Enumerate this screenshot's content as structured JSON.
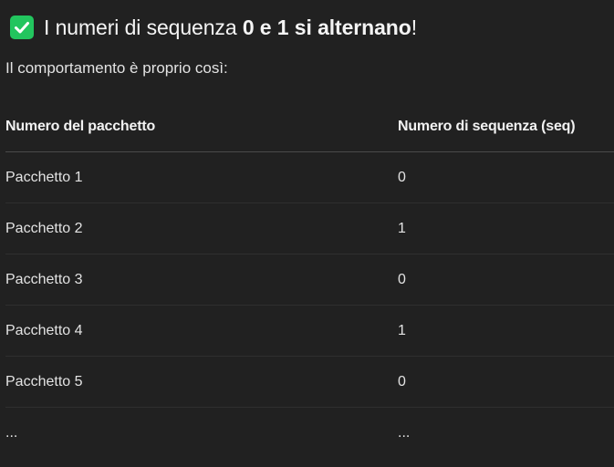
{
  "heading": {
    "icon": "check-box-icon",
    "icon_color": "#22c55e",
    "part1": "I numeri di sequenza ",
    "bold1": "0",
    "part2": " e ",
    "bold2": "1",
    "part3": " ",
    "bold3": "si alternano",
    "part4": "!"
  },
  "intro": "Il comportamento è proprio così:",
  "table": {
    "headers": [
      "Numero del pacchetto",
      "Numero di sequenza (seq)"
    ],
    "rows": [
      [
        "Pacchetto 1",
        "0"
      ],
      [
        "Pacchetto 2",
        "1"
      ],
      [
        "Pacchetto 3",
        "0"
      ],
      [
        "Pacchetto 4",
        "1"
      ],
      [
        "Pacchetto 5",
        "0"
      ],
      [
        "...",
        "..."
      ]
    ]
  }
}
